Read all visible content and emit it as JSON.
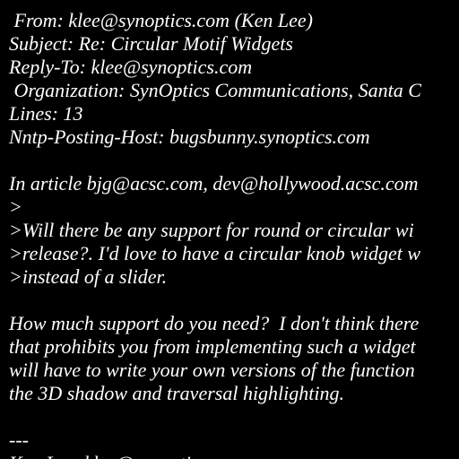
{
  "message": {
    "headers": {
      "from": " From: klee@synoptics.com (Ken Lee)",
      "subject": "Subject: Re: Circular Motif Widgets",
      "reply_to": "Reply-To: klee@synoptics.com",
      "organization": " Organization: SynOptics Communications, Santa C",
      "lines": "Lines: 13",
      "nntp_host": "Nntp-Posting-Host: bugsbunny.synoptics.com"
    },
    "quote": {
      "attribution": "In article bjg@acsc.com, dev@hollywood.acsc.com",
      "blank": ">",
      "line1": ">Will there be any support for round or circular wi",
      "line2": ">release?. I'd love to have a circular knob widget w",
      "line3": ">instead of a slider."
    },
    "body": {
      "line1": "How much support do you need?  I don't think there",
      "line2": "that prohibits you from implementing such a widget",
      "line3": "will have to write your own versions of the function",
      "line4": "the 3D shadow and traversal highlighting."
    },
    "signature": {
      "separator": "---",
      "partial": "Ken Lee, klee@synoptics.com"
    }
  },
  "colors": {
    "background": "#000000",
    "text": "#ffffff"
  }
}
